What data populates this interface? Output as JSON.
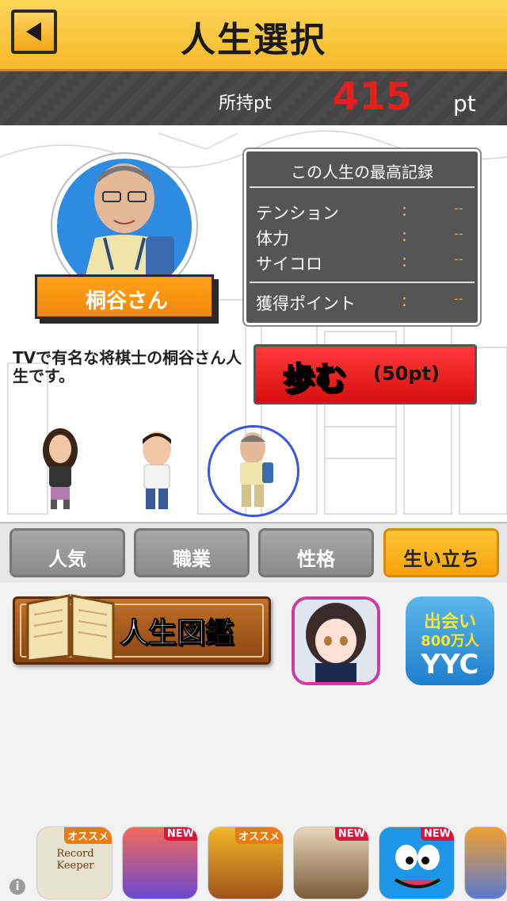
{
  "header": {
    "title": "人生選択",
    "back_icon": "back-arrow-icon"
  },
  "points": {
    "label": "所持pt",
    "value": "415",
    "unit": "pt"
  },
  "character": {
    "name": "桐谷さん",
    "description": "TVで有名な将棋士の桐谷さん人生です。"
  },
  "record": {
    "title": "この人生の最高記録",
    "rows": [
      {
        "label": "テンション",
        "colon": ":",
        "value": "--"
      },
      {
        "label": "体力",
        "colon": ":",
        "value": "--"
      },
      {
        "label": "サイコロ",
        "colon": ":",
        "value": "--"
      },
      {
        "label": "獲得ポイント",
        "colon": ":",
        "value": "--"
      }
    ]
  },
  "walk_button": {
    "label": "歩む",
    "cost": "(50pt)"
  },
  "character_list": [
    "woman-character",
    "man-character",
    "kiritani-character"
  ],
  "tabs": [
    {
      "label": "人気",
      "active": false
    },
    {
      "label": "職業",
      "active": false
    },
    {
      "label": "性格",
      "active": false
    },
    {
      "label": "生い立ち",
      "active": true
    }
  ],
  "zukan_button": {
    "label": "人生図鑑"
  },
  "yyc_app": {
    "line1": "出会い",
    "line2": "800万人",
    "line3": "YYC"
  },
  "ads": [
    {
      "name": "Record Keeper",
      "badge": "オススメ"
    },
    {
      "name": "",
      "badge": "NEW"
    },
    {
      "name": "",
      "badge": "オススメ"
    },
    {
      "name": "",
      "badge": "NEW"
    },
    {
      "name": "",
      "badge": "NEW"
    }
  ],
  "colors": {
    "accent": "#f6b92a",
    "points_red": "#e61e1e",
    "walk_red": "#d80e0e",
    "selection_blue": "#3a55e0"
  }
}
